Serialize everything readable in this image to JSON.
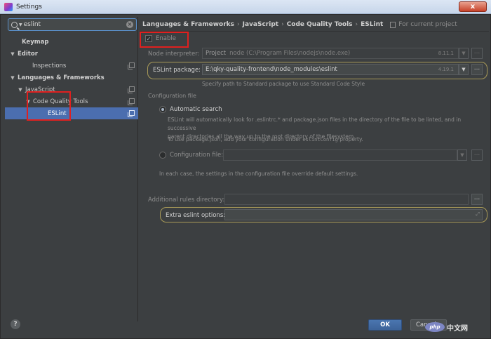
{
  "window": {
    "title": "Settings",
    "close_glyph": "x"
  },
  "search": {
    "value": "eslint",
    "placeholder": ""
  },
  "tree": [
    {
      "label": "Keymap",
      "bold": true,
      "arrow": "",
      "indent": 0,
      "copy": false,
      "selected": false
    },
    {
      "label": "Editor",
      "bold": true,
      "arrow": "▼",
      "indent": 0,
      "copy": false,
      "selected": false
    },
    {
      "label": "Inspections",
      "bold": false,
      "arrow": "",
      "indent": 1,
      "copy": true,
      "selected": false
    },
    {
      "label": "Languages & Frameworks",
      "bold": true,
      "arrow": "▼",
      "indent": 0,
      "copy": false,
      "selected": false
    },
    {
      "label": "JavaScript",
      "bold": false,
      "arrow": "▼",
      "indent": 1,
      "copy": true,
      "selected": false
    },
    {
      "label": "Code Quality Tools",
      "bold": false,
      "arrow": "▼",
      "indent": 2,
      "copy": true,
      "selected": false
    },
    {
      "label": "ESLint",
      "bold": false,
      "arrow": "",
      "indent": 3,
      "copy": true,
      "selected": true
    }
  ],
  "breadcrumb": {
    "items": [
      "Languages & Frameworks",
      "JavaScript",
      "Code Quality Tools",
      "ESLint"
    ],
    "separator": "›",
    "for_project": "For current project"
  },
  "enable": {
    "label": "Enable",
    "checked_glyph": "✓"
  },
  "node_interpreter": {
    "label": "Node interpreter:",
    "project": "Project",
    "value": "node (C:\\Program Files\\nodejs\\node.exe)",
    "version": "8.11.1"
  },
  "eslint_package": {
    "label": "ESLint package:",
    "value": "E:\\qky-quality-frontend\\node_modules\\eslint",
    "version": "4.19.1",
    "hint": "Specify path to Standard package to use Standard Code Style"
  },
  "config": {
    "section_title": "Configuration file",
    "auto_label": "Automatic search",
    "auto_desc_1": "ESLint will automatically look for .eslintrc.* and package.json files in the directory of the file to be linted, and in successive",
    "auto_desc_2": "parent directories all the way up to the root directory of the filesystem.",
    "pkg_prefix": "To use package.json, add your configuration under",
    "pkg_code": "eslintConfig",
    "pkg_suffix": "property.",
    "file_label": "Configuration file:",
    "override_note": "In each case, the settings in the configuration file override default settings."
  },
  "rules_dir": {
    "label": "Additional rules directory:",
    "value": ""
  },
  "extra_options": {
    "label": "Extra eslint options:",
    "value": ""
  },
  "buttons": {
    "ok": "OK",
    "cancel": "Cancel",
    "help": "?",
    "dots": "..."
  },
  "watermark": {
    "logo_text": "php",
    "site_text": "中文网"
  },
  "icons": {
    "dropdown": "▼",
    "expand": "⤢"
  },
  "colors": {
    "accent": "#4b6eaf",
    "highlight_red": "#e0201f",
    "highlight_oval": "#a89a58"
  }
}
